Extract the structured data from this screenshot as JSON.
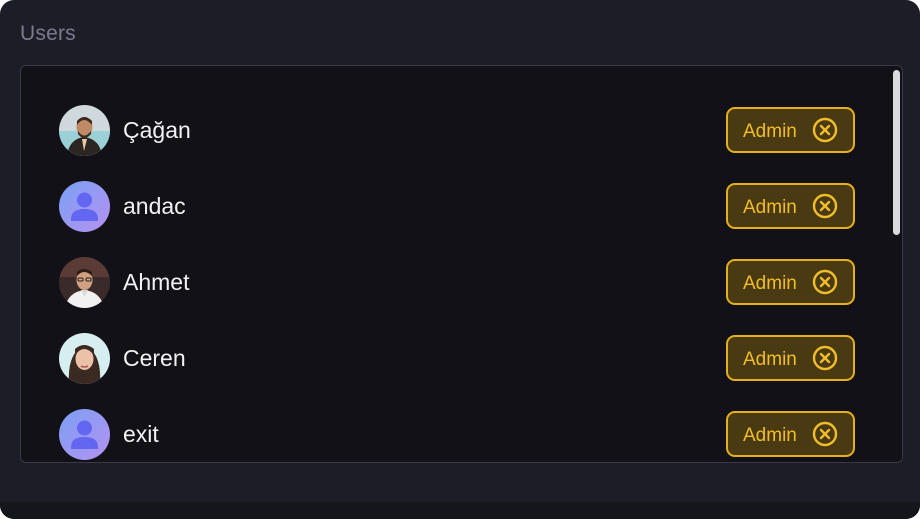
{
  "section": {
    "title": "Users"
  },
  "users": [
    {
      "name": "Çağan",
      "avatar": "photo-avatar-man-dark-shirt",
      "role": "Admin",
      "remove_icon": "close-circle-icon"
    },
    {
      "name": "andac",
      "avatar": "default-user-avatar",
      "role": "Admin",
      "remove_icon": "close-circle-icon"
    },
    {
      "name": "Ahmet",
      "avatar": "photo-avatar-man-white-shirt",
      "role": "Admin",
      "remove_icon": "close-circle-icon"
    },
    {
      "name": "Ceren",
      "avatar": "photo-avatar-woman",
      "role": "Admin",
      "remove_icon": "close-circle-icon"
    },
    {
      "name": "exit",
      "avatar": "default-user-avatar",
      "role": "Admin",
      "remove_icon": "close-circle-icon"
    }
  ],
  "colors": {
    "background": "#1d1d27",
    "panel": "#121117",
    "accent": "#f2bd2a",
    "badge_fill": "#4a3a12",
    "text": "#f2f2f5",
    "muted": "#7b7b8e"
  }
}
